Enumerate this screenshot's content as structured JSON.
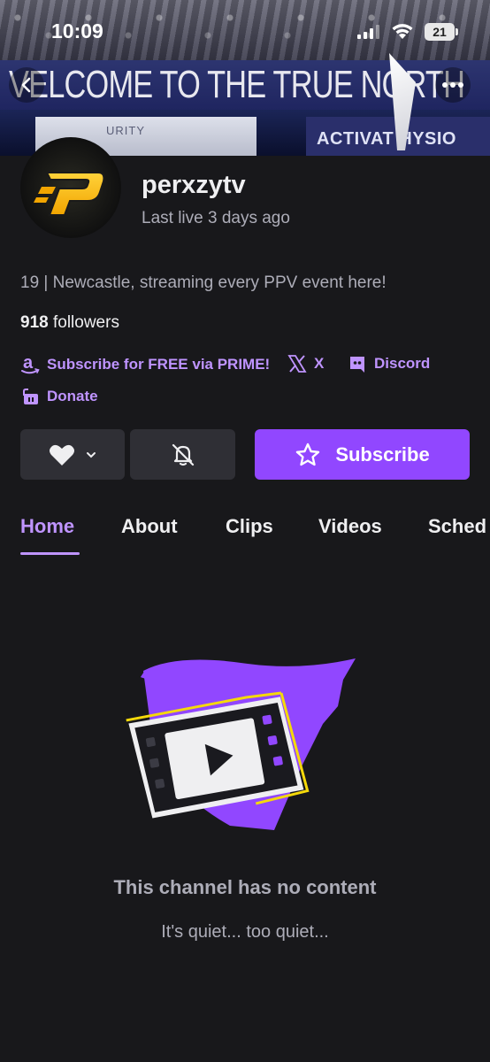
{
  "status_bar": {
    "time": "10:09",
    "battery": "21"
  },
  "banner": {
    "sign_text": "VELCOME TO THE TRUE NORTH",
    "left_ad_text": "URITY",
    "right_ad_text": "ACTIVAT  HYSIO"
  },
  "channel": {
    "name": "perxzytv",
    "last_live": "Last live 3 days ago",
    "bio": "19 | Newcastle, streaming every PPV event here!",
    "followers_count": "918",
    "followers_label": "followers"
  },
  "links": [
    {
      "label": "Subscribe for FREE via PRIME!",
      "icon": "amazon-icon"
    },
    {
      "label": "X",
      "icon": "x-logo-icon"
    },
    {
      "label": "Discord",
      "icon": "discord-icon"
    },
    {
      "label": "Donate",
      "icon": "streamlabs-icon"
    }
  ],
  "actions": {
    "subscribe_label": "Subscribe"
  },
  "tabs": [
    {
      "label": "Home",
      "active": true
    },
    {
      "label": "About"
    },
    {
      "label": "Clips"
    },
    {
      "label": "Videos"
    },
    {
      "label": "Sched"
    }
  ],
  "empty_state": {
    "title": "This channel has no content",
    "subtitle": "It's quiet... too quiet..."
  },
  "colors": {
    "accent": "#bf94ff",
    "brand": "#9147ff",
    "background": "#18181b",
    "button": "#2f2f35"
  }
}
